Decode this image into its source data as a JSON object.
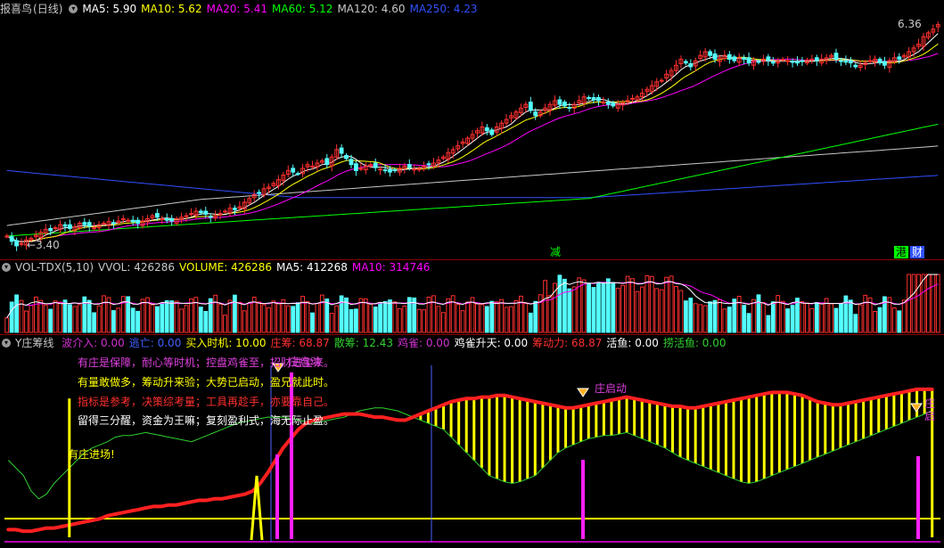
{
  "main_header": {
    "stock_name": "报喜鸟",
    "period": "(日线)",
    "ma5": "MA5: 5.90",
    "ma10": "MA10: 5.62",
    "ma20": "MA20: 5.41",
    "ma60": "MA60: 5.12",
    "ma120": "MA120: 4.60",
    "ma250": "MA250: 4.23"
  },
  "price_labels": {
    "high": "6.36",
    "low": "3.40"
  },
  "event_tags": {
    "jian": "减",
    "gang": "港",
    "cai": "财"
  },
  "vol_header": {
    "name": "VOL-TDX(5,10)",
    "vvol": "VVOL: 426286",
    "volume": "VOLUME: 426286",
    "ma5": "MA5: 412268",
    "ma10": "MA10: 314746"
  },
  "ind_header": {
    "name": "Y庄筹线",
    "items": [
      {
        "label": "波介入:",
        "value": "0.00",
        "color": "#d030d0"
      },
      {
        "label": "逃亡:",
        "value": "0.00",
        "color": "#4060ff"
      },
      {
        "label": "买入时机:",
        "value": "10.00",
        "color": "#ffff00"
      },
      {
        "label": "庄筹:",
        "value": "68.87",
        "color": "#ff3030"
      },
      {
        "label": "散筹:",
        "value": "12.43",
        "color": "#30d030"
      },
      {
        "label": "鸡雀:",
        "value": "0.00",
        "color": "#d030d0"
      },
      {
        "label": "鸡雀升天:",
        "value": "0.00",
        "color": "#ffffff"
      },
      {
        "label": "筹动力:",
        "value": "68.87",
        "color": "#ff3030"
      },
      {
        "label": "活鱼:",
        "value": "0.00",
        "color": "#ffffff"
      },
      {
        "label": "捞活鱼:",
        "value": "0.00",
        "color": "#30d030"
      }
    ]
  },
  "annotations": [
    {
      "text": "有庄是保障，耐心等时机；控盘鸡雀至，招财进宝来。",
      "color": "#e040e0"
    },
    {
      "text": "有量敢做多，筹动升来验；大势已启动，盈兄就此时。",
      "color": "#ffff00"
    },
    {
      "text": "指标是参考，决策综考量；工具再趁手，亦要靠自己。",
      "color": "#ff3030"
    },
    {
      "text": "留得三分醒，资金为王嘛；复刻盈利式，海无际止盈。",
      "color": "#ffffff"
    }
  ],
  "signals": {
    "entry": "有庄进场!",
    "start1": "庄启动",
    "start2": "庄启动",
    "start3": "庄启"
  },
  "colors": {
    "ma5": "#ffffff",
    "ma10": "#ffff00",
    "ma20": "#ff00ff",
    "ma60": "#00ff00",
    "ma120": "#c8c8c8",
    "ma250": "#3050ff",
    "up": "#ff3030",
    "down": "#54ffff"
  },
  "chart_data": [
    {
      "type": "candlestick",
      "title": "报喜鸟(日线)",
      "ylim": [
        3.3,
        6.45
      ],
      "max_label": 6.36,
      "min_label": 3.4,
      "close": [
        3.55,
        3.48,
        3.42,
        3.45,
        3.5,
        3.52,
        3.56,
        3.6,
        3.64,
        3.62,
        3.66,
        3.7,
        3.68,
        3.65,
        3.67,
        3.72,
        3.7,
        3.68,
        3.66,
        3.7,
        3.72,
        3.74,
        3.72,
        3.75,
        3.78,
        3.76,
        3.74,
        3.72,
        3.75,
        3.78,
        3.82,
        3.8,
        3.78,
        3.76,
        3.75,
        3.78,
        3.8,
        3.82,
        3.85,
        3.88,
        3.86,
        3.84,
        3.8,
        3.82,
        3.85,
        3.88,
        3.92,
        3.9,
        3.94,
        4.0,
        4.05,
        4.1,
        4.12,
        4.18,
        4.2,
        4.25,
        4.3,
        4.36,
        4.42,
        4.4,
        4.38,
        4.45,
        4.5,
        4.48,
        4.52,
        4.55,
        4.5,
        4.6,
        4.7,
        4.65,
        4.58,
        4.5,
        4.42,
        4.45,
        4.48,
        4.5,
        4.46,
        4.44,
        4.42,
        4.4,
        4.42,
        4.45,
        4.48,
        4.46,
        4.44,
        4.45,
        4.48,
        4.5,
        4.52,
        4.56,
        4.6,
        4.66,
        4.7,
        4.75,
        4.8,
        4.85,
        4.9,
        4.95,
        5.0,
        4.95,
        4.9,
        5.0,
        5.05,
        5.1,
        5.15,
        5.2,
        5.25,
        5.3,
        5.22,
        5.15,
        5.2,
        5.25,
        5.3,
        5.35,
        5.3,
        5.28,
        5.25,
        5.3,
        5.35,
        5.4,
        5.38,
        5.36,
        5.35,
        5.33,
        5.3,
        5.28,
        5.3,
        5.32,
        5.35,
        5.38,
        5.4,
        5.45,
        5.5,
        5.55,
        5.6,
        5.62,
        5.7,
        5.75,
        5.82,
        5.9,
        5.85,
        5.8,
        5.88,
        5.95,
        6.0,
        5.95,
        5.9,
        5.92,
        5.95,
        5.9,
        5.88,
        5.92,
        5.9,
        5.85,
        5.88,
        5.86,
        5.9,
        5.88,
        5.85,
        5.87,
        5.9,
        5.88,
        5.86,
        5.85,
        5.87,
        5.89,
        5.9,
        5.88,
        5.9,
        5.92,
        5.95,
        5.9,
        5.88,
        5.86,
        5.85,
        5.8,
        5.82,
        5.85,
        5.88,
        5.9,
        5.85,
        5.82,
        5.88,
        5.92,
        5.9,
        5.95,
        6.0,
        6.05,
        6.1,
        6.2,
        6.25,
        6.3,
        6.36
      ],
      "ma_lines": [
        "MA5",
        "MA10",
        "MA20",
        "MA60",
        "MA120",
        "MA250"
      ]
    },
    {
      "type": "bar",
      "title": "VOL-TDX(5,10)",
      "series": [
        {
          "name": "VOLUME"
        },
        {
          "name": "MA5"
        },
        {
          "name": "MA10"
        }
      ],
      "last_values": {
        "VOLUME": 426286,
        "MA5": 412268,
        "MA10": 314746
      }
    },
    {
      "type": "line",
      "title": "Y庄筹线",
      "ylim": [
        0,
        100
      ],
      "series": [
        {
          "name": "庄筹",
          "values": [
            5,
            5,
            4,
            4,
            5,
            6,
            6,
            7,
            8,
            9,
            10,
            11,
            12,
            14,
            15,
            16,
            17,
            18,
            19,
            20,
            20,
            21,
            21,
            22,
            23,
            24,
            24,
            25,
            25,
            26,
            27,
            28,
            30,
            35,
            42,
            50,
            58,
            64,
            70,
            74,
            76,
            77,
            78,
            79,
            80,
            80,
            80,
            79,
            78,
            78,
            77,
            76,
            76,
            78,
            80,
            82,
            84,
            86,
            88,
            89,
            90,
            90,
            91,
            91,
            92,
            92,
            91,
            90,
            89,
            88,
            87,
            86,
            85,
            84,
            84,
            85,
            86,
            87,
            88,
            89,
            90,
            91,
            90,
            89,
            88,
            87,
            86,
            85,
            85,
            84,
            84,
            85,
            86,
            87,
            88,
            89,
            90,
            91,
            92,
            93,
            94,
            94,
            94,
            93,
            92,
            90,
            88,
            87,
            86,
            86,
            87,
            88,
            89,
            90,
            91,
            92,
            93,
            94,
            95,
            96,
            96,
            96
          ]
        },
        {
          "name": "散筹",
          "values": [
            50,
            45,
            40,
            30,
            25,
            28,
            35,
            40,
            45,
            50,
            55,
            58,
            60,
            62,
            65,
            66,
            66,
            67,
            68,
            67,
            66,
            65,
            64,
            63,
            62,
            64,
            66,
            68,
            70,
            72,
            74,
            75,
            76,
            77,
            78,
            78,
            78,
            77,
            76,
            75,
            74,
            75,
            76,
            77,
            78,
            80,
            82,
            83,
            84,
            84,
            83,
            82,
            80,
            78,
            76,
            74,
            72,
            70,
            65,
            60,
            55,
            50,
            45,
            40,
            38,
            36,
            35,
            36,
            38,
            40,
            45,
            50,
            55,
            58,
            60,
            62,
            64,
            65,
            66,
            66,
            67,
            68,
            66,
            64,
            62,
            60,
            58,
            55,
            52,
            50,
            48,
            46,
            44,
            42,
            40,
            38,
            36,
            35,
            36,
            38,
            40,
            42,
            44,
            46,
            48,
            50,
            52,
            54,
            56,
            58,
            60,
            62,
            64,
            66,
            68,
            70,
            72,
            74,
            76,
            78,
            80,
            82
          ]
        },
        {
          "name": "买入时机",
          "values": [
            0,
            0,
            0,
            0,
            0,
            0,
            0,
            0,
            10,
            0,
            0,
            0,
            0,
            0,
            0,
            0,
            0,
            0,
            0,
            0,
            0,
            0,
            0,
            0,
            0,
            0,
            0,
            0,
            0,
            0,
            0,
            0,
            0,
            0,
            0,
            0,
            0,
            0,
            0,
            0,
            0,
            0,
            0,
            0,
            0,
            0,
            0,
            0,
            0,
            0,
            0,
            0,
            0,
            0,
            0,
            0,
            0,
            0,
            0,
            0,
            0,
            0,
            0,
            0,
            0,
            0,
            0,
            0,
            0,
            0,
            0,
            0,
            0,
            0,
            0,
            0,
            0,
            0,
            0,
            0,
            0,
            0,
            0,
            0,
            0,
            0,
            0,
            0,
            0,
            0,
            0,
            0,
            0,
            0,
            0,
            0,
            0,
            0,
            0,
            0,
            0,
            0,
            0,
            0,
            0,
            0,
            0,
            0,
            0,
            0,
            0,
            0,
            0,
            0,
            0,
            0,
            0,
            0,
            0,
            0,
            0,
            10
          ]
        }
      ]
    }
  ]
}
